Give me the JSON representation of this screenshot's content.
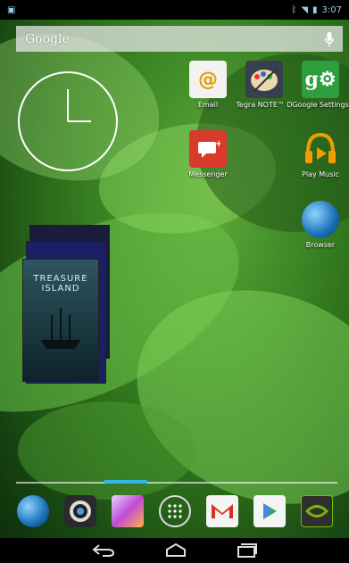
{
  "status": {
    "time": "3:07"
  },
  "search": {
    "label": "Google"
  },
  "apps": [
    {
      "label": "Email",
      "icon": "email-icon"
    },
    {
      "label": "Tegra NOTE™ D",
      "icon": "tegra-note-icon"
    },
    {
      "label": "Google Settings",
      "icon": "google-settings-icon"
    },
    {
      "label": "Messenger",
      "icon": "messenger-icon"
    },
    {
      "label": "Play Music",
      "icon": "play-music-icon"
    },
    {
      "label": "Browser",
      "icon": "browser-icon"
    }
  ],
  "books": {
    "front_title_line1": "TREASURE",
    "front_title_line2": "ISLAND"
  },
  "dock": [
    "browser-icon",
    "camera-icon",
    "gallery-icon",
    "app-drawer-icon",
    "gmail-icon",
    "play-store-icon",
    "nvidia-icon"
  ],
  "colors": {
    "accent": "#33b5e5",
    "status_icons": "#9acfe8"
  }
}
